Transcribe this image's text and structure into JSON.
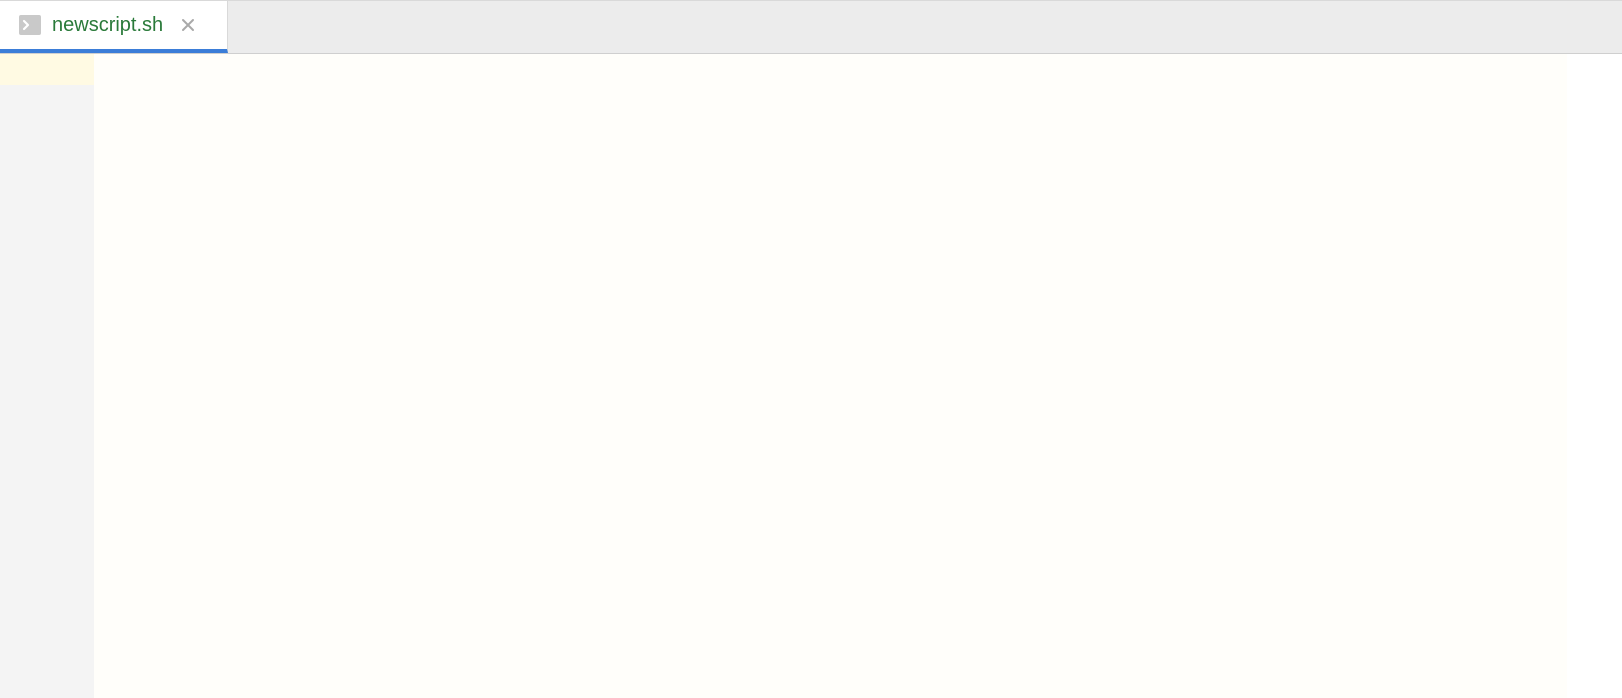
{
  "tabs": [
    {
      "filename": "newscript.sh",
      "active": true
    }
  ],
  "editor": {
    "content": ""
  }
}
